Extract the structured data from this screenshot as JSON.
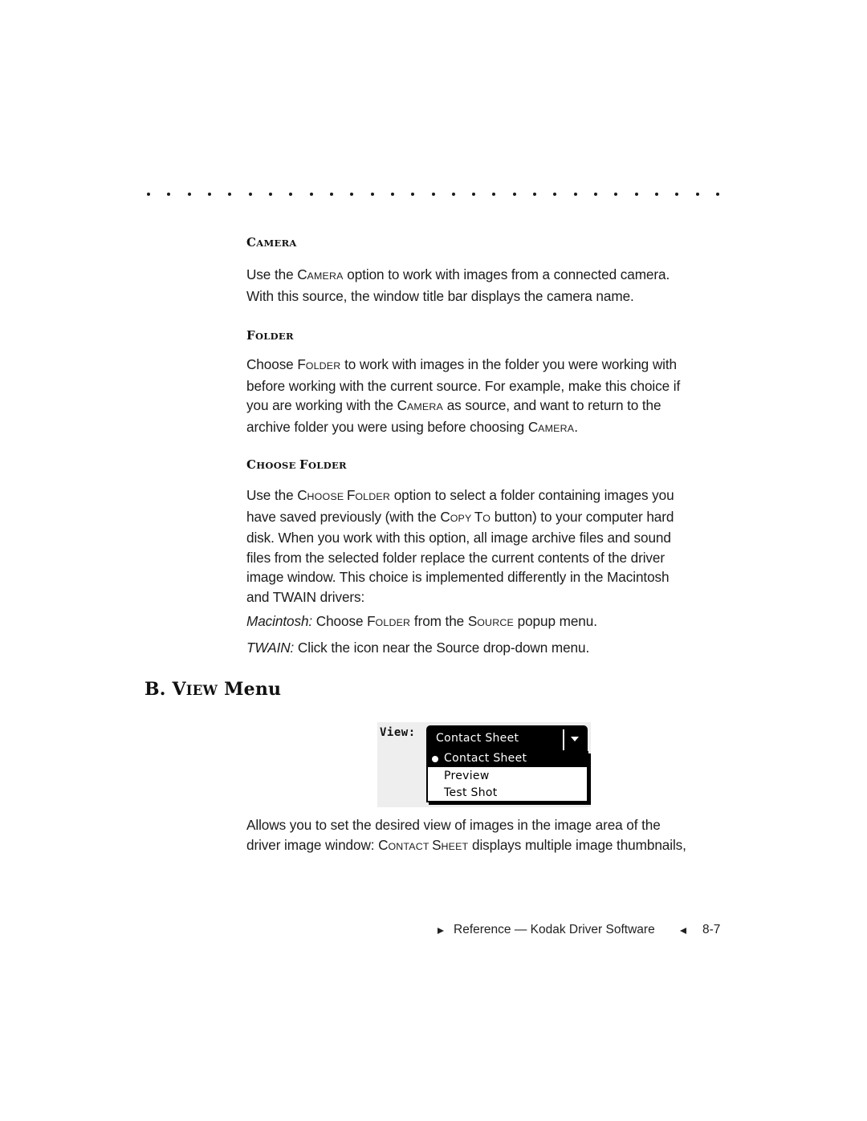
{
  "rule": {
    "dot_count": 29
  },
  "sections": {
    "camera": {
      "heading_cap": "C",
      "heading_rest": "AMERA",
      "p1_a": "Use the ",
      "p1_sc_cap": "C",
      "p1_sc": "AMERA",
      "p1_b": " option to work with images from a connected camera.",
      "p2": "With this source, the window title bar displays the camera name."
    },
    "folder": {
      "heading_cap": "F",
      "heading_rest": "OLDER",
      "l1_a": "Choose ",
      "l1_sc_cap": "F",
      "l1_sc": "OLDER",
      "l1_b": " to work with images in the folder you were working with",
      "l2": "before working with the current source. For example, make this choice if",
      "l3_a": "you are working with the ",
      "l3_sc_cap": "C",
      "l3_sc": "AMERA",
      "l3_b": " as source, and want to return to the",
      "l4_a": "archive folder you were using before choosing ",
      "l4_sc_cap": "C",
      "l4_sc": "AMERA",
      "l4_b": "."
    },
    "choose_folder": {
      "heading_cap1": "C",
      "heading_rest1": "HOOSE ",
      "heading_cap2": "F",
      "heading_rest2": "OLDER",
      "l1_a": "Use the ",
      "l1_sc1_cap": "C",
      "l1_sc1": "HOOSE ",
      "l1_sc2_cap": "F",
      "l1_sc2": "OLDER",
      "l1_b": " option to select a folder containing images you",
      "l2_a": "have saved previously (with the ",
      "l2_sc1_cap": "C",
      "l2_sc1": "OPY ",
      "l2_sc2_cap": "T",
      "l2_sc2": "O",
      "l2_b": " button) to your computer hard",
      "l3": "disk. When you work with this option, all image archive files and sound",
      "l4": "files from the selected folder replace the current contents of the driver",
      "l5": "image window. This choice is implemented differently in the Macintosh",
      "l6": "and TWAIN drivers:",
      "mac_label": "Macintosh:",
      "mac_a": " Choose ",
      "mac_sc1_cap": "F",
      "mac_sc1": "OLDER",
      "mac_b": " from the ",
      "mac_sc2_cap": "S",
      "mac_sc2": "OURCE",
      "mac_c": " popup menu.",
      "twain_label": "TWAIN:",
      "twain_text": " Click the icon near the Source drop-down menu."
    },
    "view_menu": {
      "heading_prefix": "B. ",
      "heading_cap": "V",
      "heading_sc": "IEW",
      "heading_suffix": " Menu",
      "screenshot": {
        "label": "View:",
        "selected_value": "Contact Sheet",
        "options": [
          "Contact Sheet",
          "Preview",
          "Test Shot"
        ],
        "selected_index": 0
      },
      "l1": "Allows you to set the desired view of images in the image area of the",
      "l2_a": "driver image window: ",
      "l2_sc1_cap": "C",
      "l2_sc1": "ONTACT ",
      "l2_sc2_cap": "S",
      "l2_sc2": "HEET",
      "l2_b": " displays multiple image thumbnails,"
    }
  },
  "footer": {
    "text": "Reference — Kodak Driver Software",
    "page_number": "8-7"
  }
}
